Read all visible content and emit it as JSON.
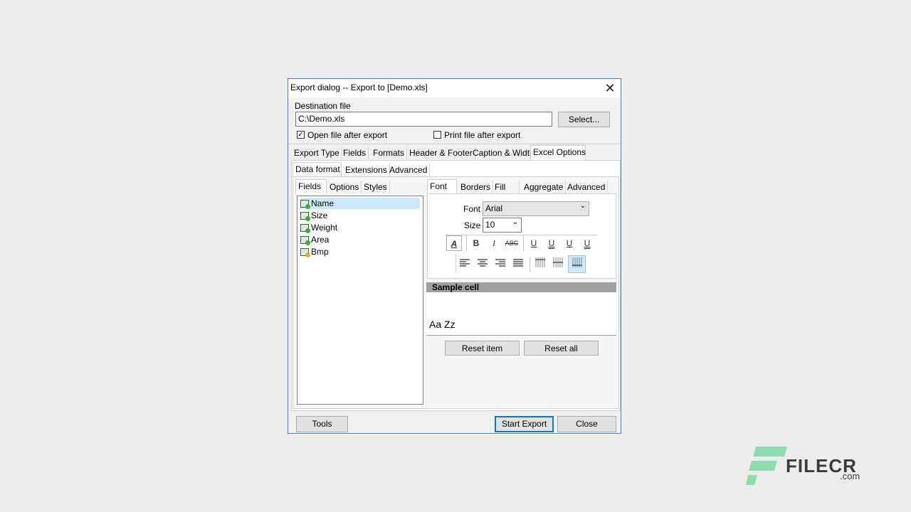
{
  "dialog": {
    "title": "Export dialog -- Export to [Demo.xls]",
    "close_glyph": "✕",
    "destination_label": "Destination file",
    "destination_value": "C:\\Demo.xls",
    "select_button": "Select...",
    "open_after_label": "Open file after export",
    "open_after_checked": true,
    "print_after_label": "Print file after export",
    "print_after_checked": false,
    "check_glyph": "✓"
  },
  "main_tabs": [
    "Export Type",
    "Fields",
    "Formats",
    "Header & Footer",
    "Caption & Width",
    "Excel Options"
  ],
  "sub_tabs": [
    "Data format",
    "Extensions",
    "Advanced"
  ],
  "left_tabs": [
    "Fields",
    "Options",
    "Styles"
  ],
  "fields": [
    "Name",
    "Size",
    "Weight",
    "Area",
    "Bmp"
  ],
  "right_tabs": [
    "Font",
    "Borders",
    "Fill",
    "Aggregate",
    "Advanced"
  ],
  "font": {
    "font_label": "Font",
    "font_value": "Arial",
    "size_label": "Size",
    "size_value": "10"
  },
  "toolbar": {
    "color_glyph": "A",
    "bold_glyph": "B",
    "italic_glyph": "I",
    "strike_glyph": "ABC",
    "underline_glyph": "U"
  },
  "sample": {
    "header": "Sample cell",
    "text": "Aa Zz",
    "reset_item": "Reset item",
    "reset_all": "Reset all"
  },
  "footer": {
    "tools": "Tools",
    "start_export": "Start Export",
    "close": "Close"
  },
  "watermark": {
    "brand": "FILECR",
    "suffix": ".com"
  },
  "colors": {
    "accent": "#0078d7",
    "selection": "#cce8ff",
    "sample_header": "#a0a0a0"
  }
}
